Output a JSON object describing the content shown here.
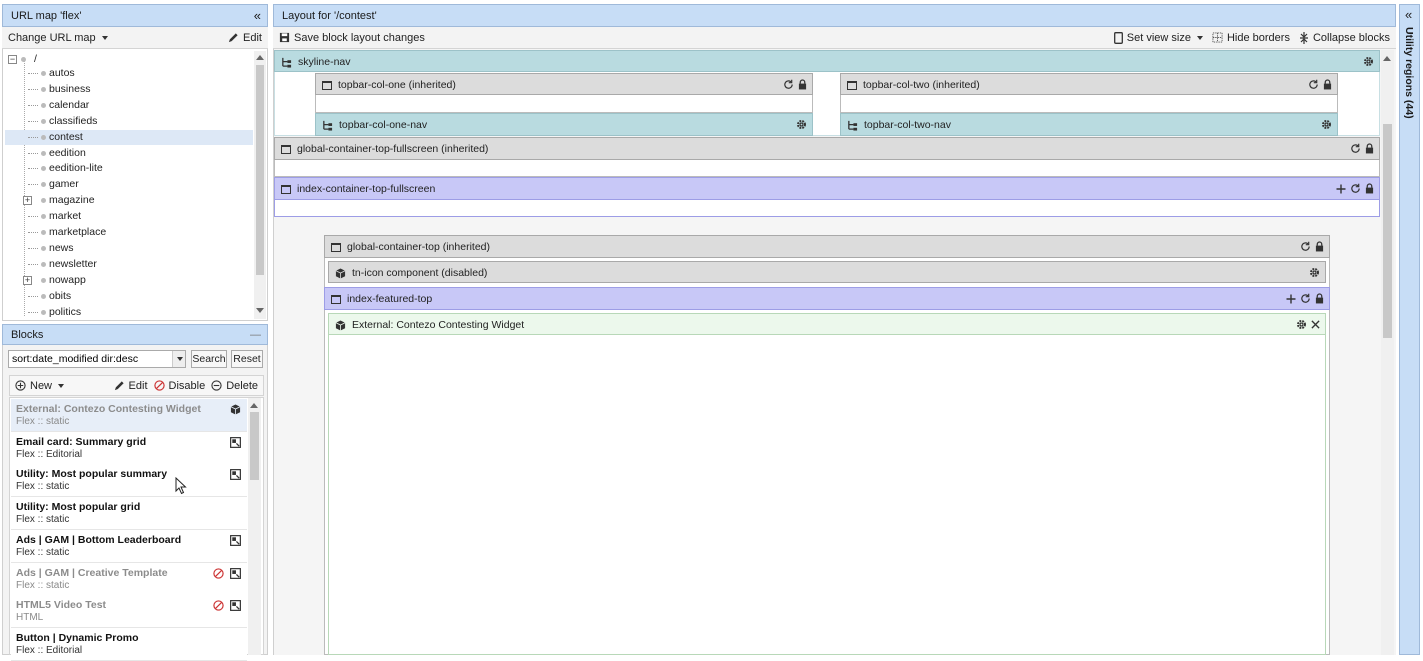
{
  "left_top": {
    "title": "URL map 'flex'",
    "collapse_label": "«",
    "change_map_label": "Change URL map",
    "edit_label": "Edit",
    "tree_root": "/",
    "tree_items": [
      {
        "label": "autos",
        "expandable": false,
        "selected": false
      },
      {
        "label": "business",
        "expandable": false,
        "selected": false
      },
      {
        "label": "calendar",
        "expandable": false,
        "selected": false
      },
      {
        "label": "classifieds",
        "expandable": false,
        "selected": false
      },
      {
        "label": "contest",
        "expandable": false,
        "selected": true
      },
      {
        "label": "eedition",
        "expandable": false,
        "selected": false
      },
      {
        "label": "eedition-lite",
        "expandable": false,
        "selected": false
      },
      {
        "label": "gamer",
        "expandable": false,
        "selected": false
      },
      {
        "label": "magazine",
        "expandable": true,
        "selected": false
      },
      {
        "label": "market",
        "expandable": false,
        "selected": false
      },
      {
        "label": "marketplace",
        "expandable": false,
        "selected": false
      },
      {
        "label": "news",
        "expandable": false,
        "selected": false
      },
      {
        "label": "newsletter",
        "expandable": false,
        "selected": false
      },
      {
        "label": "nowapp",
        "expandable": true,
        "selected": false
      },
      {
        "label": "obits",
        "expandable": false,
        "selected": false
      },
      {
        "label": "politics",
        "expandable": false,
        "selected": false
      }
    ]
  },
  "blocks": {
    "title": "Blocks",
    "minimize_label": "—",
    "search_value": "sort:date_modified dir:desc",
    "search_button": "Search",
    "reset_button": "Reset",
    "new_label": "New",
    "edit_label": "Edit",
    "disable_label": "Disable",
    "delete_label": "Delete",
    "items": [
      {
        "title": "External: Contezo Contesting Widget",
        "sub": "Flex :: static",
        "dim": true,
        "disabled": false,
        "icon": "cube-icon"
      },
      {
        "title": "Email card: Summary grid",
        "sub": "Flex :: Editorial",
        "dim": false,
        "disabled": false,
        "icon": "block-icon"
      },
      {
        "title": "Utility: Most popular summary",
        "sub": "Flex :: static",
        "dim": false,
        "disabled": false,
        "icon": "block-icon"
      },
      {
        "title": "Utility: Most popular grid",
        "sub": "Flex :: static",
        "dim": false,
        "disabled": false,
        "icon": ""
      },
      {
        "title": "Ads | GAM | Bottom Leaderboard",
        "sub": "Flex :: static",
        "dim": false,
        "disabled": false,
        "icon": "block-icon"
      },
      {
        "title": "Ads | GAM | Creative Template",
        "sub": "Flex :: static",
        "dim": true,
        "disabled": true,
        "icon": "block-icon"
      },
      {
        "title": "HTML5 Video Test",
        "sub": "HTML",
        "dim": true,
        "disabled": true,
        "icon": "block-icon"
      },
      {
        "title": "Button | Dynamic Promo",
        "sub": "Flex :: Editorial",
        "dim": false,
        "disabled": false,
        "icon": ""
      }
    ]
  },
  "layout": {
    "title": "Layout for '/contest'",
    "save_label": "Save block layout changes",
    "view_size_label": "Set view size",
    "hide_borders_label": "Hide borders",
    "collapse_blocks_label": "Collapse blocks",
    "regions": {
      "skyline_nav": "skyline-nav",
      "topbar_col_one": "topbar-col-one (inherited)",
      "topbar_col_two": "topbar-col-two (inherited)",
      "topbar_col_one_nav": "topbar-col-one-nav",
      "topbar_col_two_nav": "topbar-col-two-nav",
      "global_container_top_fullscreen": "global-container-top-fullscreen (inherited)",
      "index_container_top_fullscreen": "index-container-top-fullscreen",
      "global_container_top": "global-container-top (inherited)",
      "tn_icon_component": "tn-icon component (disabled)",
      "index_featured_top": "index-featured-top",
      "external_widget": "External: Contezo Contesting Widget"
    }
  },
  "utility": {
    "label": "Utility regions (44)",
    "expand_label": "«"
  },
  "colors": {
    "panel_header": "#c7ddf6",
    "region_gray": "#dcdcdc",
    "region_teal": "#b9dbe0",
    "region_lavender": "#c8c8f7",
    "region_green": "#ecf8ec"
  }
}
